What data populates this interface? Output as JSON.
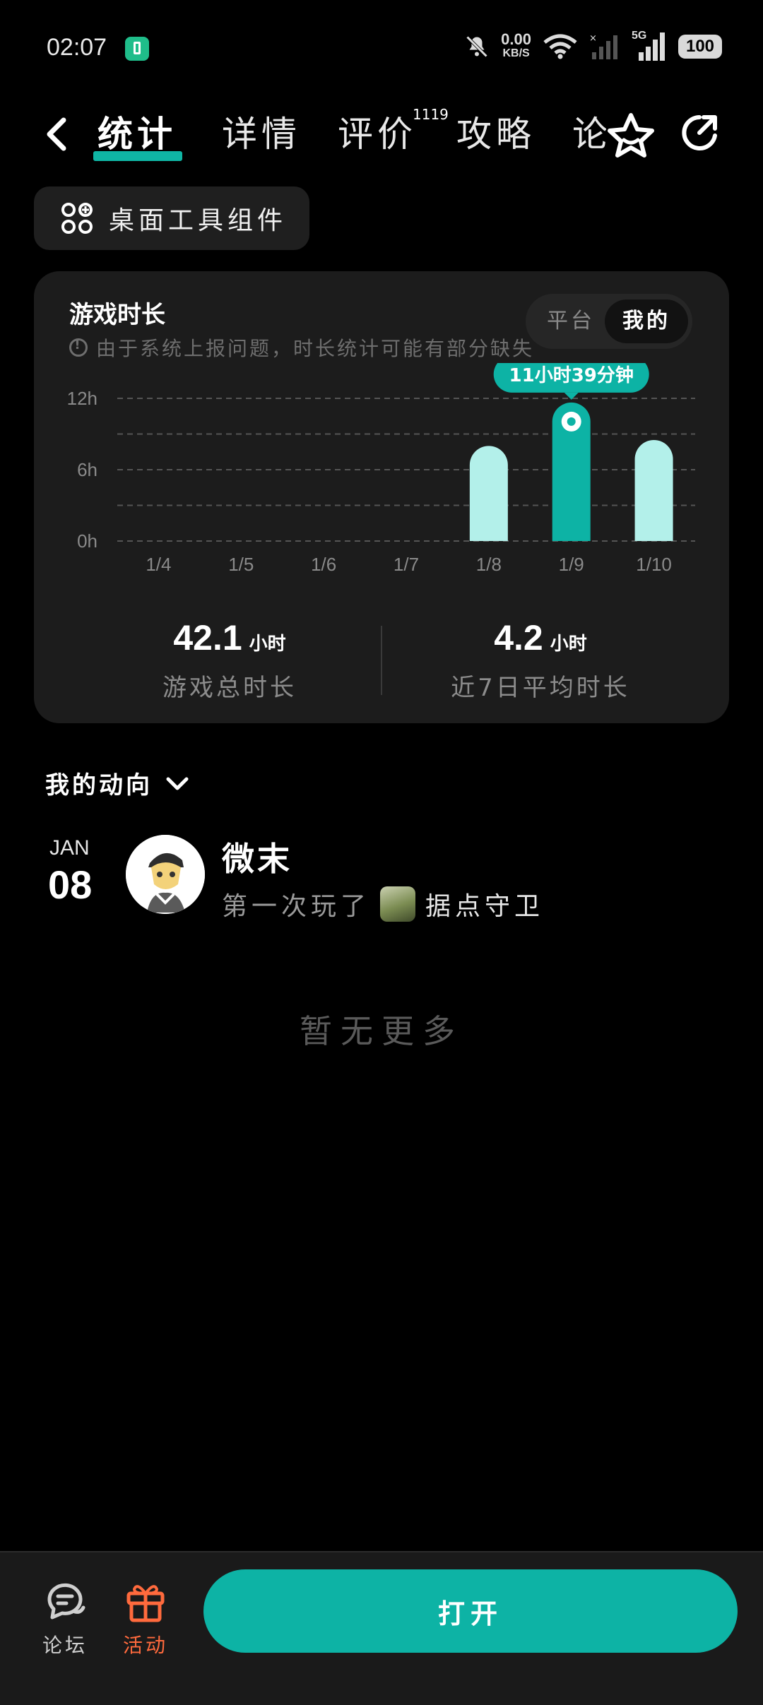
{
  "status_bar": {
    "time": "02:07",
    "net_speed_value": "0.00",
    "net_speed_unit": "KB/S",
    "network_label": "5G",
    "battery": "100"
  },
  "tabs": {
    "items": [
      {
        "label": "统计",
        "active": true
      },
      {
        "label": "详情"
      },
      {
        "label": "评价"
      },
      {
        "label": "攻略"
      },
      {
        "label": "论"
      }
    ],
    "review_count": "1119"
  },
  "widget_button": {
    "label": "桌面工具组件"
  },
  "stats_card": {
    "title": "游戏时长",
    "note": "由于系统上报问题，时长统计可能有部分缺失",
    "toggle": {
      "platform": "平台",
      "mine": "我的",
      "selected": "我的"
    },
    "metrics": [
      {
        "value": "42.1",
        "unit": "小时",
        "caption": "游戏总时长"
      },
      {
        "value": "4.2",
        "unit": "小时",
        "caption": "近7日平均时长"
      }
    ]
  },
  "chart_data": {
    "type": "bar",
    "categories": [
      "1/4",
      "1/5",
      "1/6",
      "1/7",
      "1/8",
      "1/9",
      "1/10"
    ],
    "values": [
      0,
      0,
      0,
      0,
      8.0,
      11.65,
      8.5
    ],
    "unit": "h",
    "yticks": [
      "0h",
      "6h",
      "12h"
    ],
    "ylim": [
      0,
      12
    ],
    "highlight_index": 5,
    "tooltip": "11小时39分钟",
    "grid": "dashed",
    "colors": {
      "bar": "#b3f0ea",
      "highlight": "#0db3a5",
      "grid": "#555555",
      "tick": "#8a8a8a"
    }
  },
  "activity": {
    "section_title": "我的动向",
    "entries": [
      {
        "month": "JAN",
        "day": "08",
        "user": "微末",
        "text": "第一次玩了",
        "game": "据点守卫"
      }
    ],
    "no_more": "暂无更多"
  },
  "bottom_bar": {
    "forum_label": "论坛",
    "event_label": "活动",
    "open_button": "打开",
    "colors": {
      "accent": "#0db3a5",
      "event": "#ff6a3d"
    }
  }
}
